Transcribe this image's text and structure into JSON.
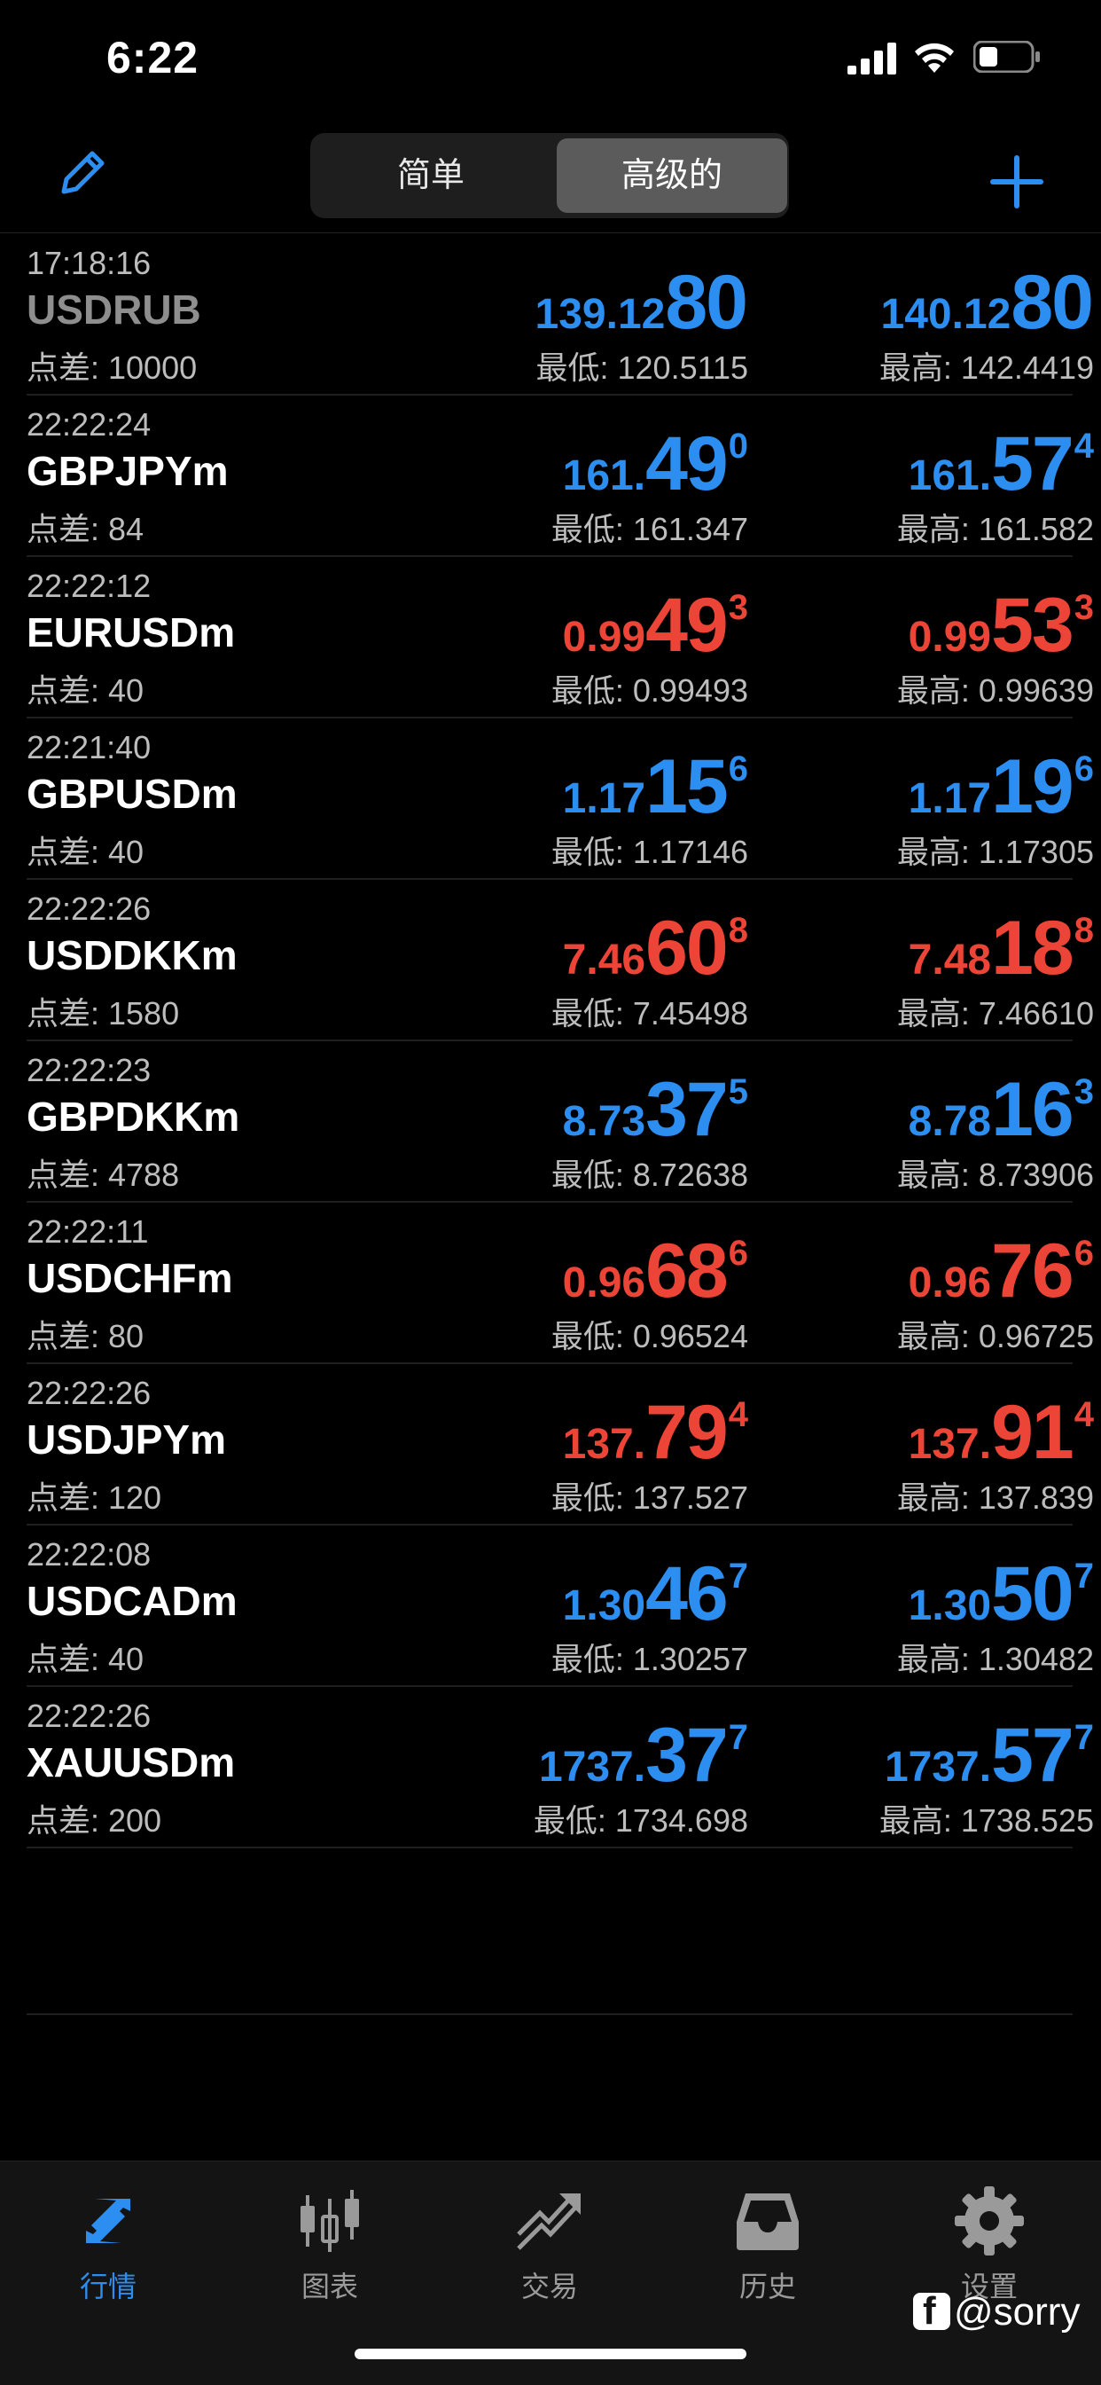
{
  "status": {
    "time": "6:22"
  },
  "segmented": {
    "simple": "简单",
    "advanced": "高级的"
  },
  "quotes": [
    {
      "time": "17:18:16",
      "symbol": "USDRUB",
      "spread": "点差: 10000",
      "color": "blue",
      "dim": true,
      "bid": {
        "small": "139.12",
        "big": "80",
        "sup": ""
      },
      "ask": {
        "small": "140.12",
        "big": "80",
        "sup": ""
      },
      "low": "最低: 120.5115",
      "high": "最高: 142.4419"
    },
    {
      "time": "22:22:24",
      "symbol": "GBPJPYm",
      "spread": "点差: 84",
      "color": "blue",
      "dim": false,
      "bid": {
        "small": "161.",
        "big": "49",
        "sup": "0"
      },
      "ask": {
        "small": "161.",
        "big": "57",
        "sup": "4"
      },
      "low": "最低: 161.347",
      "high": "最高: 161.582"
    },
    {
      "time": "22:22:12",
      "symbol": "EURUSDm",
      "spread": "点差: 40",
      "color": "red",
      "dim": false,
      "bid": {
        "small": "0.99",
        "big": "49",
        "sup": "3"
      },
      "ask": {
        "small": "0.99",
        "big": "53",
        "sup": "3"
      },
      "low": "最低: 0.99493",
      "high": "最高: 0.99639"
    },
    {
      "time": "22:21:40",
      "symbol": "GBPUSDm",
      "spread": "点差: 40",
      "color": "blue",
      "dim": false,
      "bid": {
        "small": "1.17",
        "big": "15",
        "sup": "6"
      },
      "ask": {
        "small": "1.17",
        "big": "19",
        "sup": "6"
      },
      "low": "最低: 1.17146",
      "high": "最高: 1.17305"
    },
    {
      "time": "22:22:26",
      "symbol": "USDDKKm",
      "spread": "点差: 1580",
      "color": "red",
      "dim": false,
      "bid": {
        "small": "7.46",
        "big": "60",
        "sup": "8"
      },
      "ask": {
        "small": "7.48",
        "big": "18",
        "sup": "8"
      },
      "low": "最低: 7.45498",
      "high": "最高: 7.46610"
    },
    {
      "time": "22:22:23",
      "symbol": "GBPDKKm",
      "spread": "点差: 4788",
      "color": "blue",
      "dim": false,
      "bid": {
        "small": "8.73",
        "big": "37",
        "sup": "5"
      },
      "ask": {
        "small": "8.78",
        "big": "16",
        "sup": "3"
      },
      "low": "最低: 8.72638",
      "high": "最高: 8.73906"
    },
    {
      "time": "22:22:11",
      "symbol": "USDCHFm",
      "spread": "点差: 80",
      "color": "red",
      "dim": false,
      "bid": {
        "small": "0.96",
        "big": "68",
        "sup": "6"
      },
      "ask": {
        "small": "0.96",
        "big": "76",
        "sup": "6"
      },
      "low": "最低: 0.96524",
      "high": "最高: 0.96725"
    },
    {
      "time": "22:22:26",
      "symbol": "USDJPYm",
      "spread": "点差: 120",
      "color": "red",
      "dim": false,
      "bid": {
        "small": "137.",
        "big": "79",
        "sup": "4"
      },
      "ask": {
        "small": "137.",
        "big": "91",
        "sup": "4"
      },
      "low": "最低: 137.527",
      "high": "最高: 137.839"
    },
    {
      "time": "22:22:08",
      "symbol": "USDCADm",
      "spread": "点差: 40",
      "color": "blue",
      "dim": false,
      "bid": {
        "small": "1.30",
        "big": "46",
        "sup": "7"
      },
      "ask": {
        "small": "1.30",
        "big": "50",
        "sup": "7"
      },
      "low": "最低: 1.30257",
      "high": "最高: 1.30482"
    },
    {
      "time": "22:22:26",
      "symbol": "XAUUSDm",
      "spread": "点差: 200",
      "color": "blue",
      "dim": false,
      "bid": {
        "small": "1737.",
        "big": "37",
        "sup": "7"
      },
      "ask": {
        "small": "1737.",
        "big": "57",
        "sup": "7"
      },
      "low": "最低: 1734.698",
      "high": "最高: 1738.525"
    }
  ],
  "tabs": [
    {
      "label": "行情",
      "icon": "quotes-arrows-icon",
      "active": true
    },
    {
      "label": "图表",
      "icon": "candlestick-chart-icon",
      "active": false
    },
    {
      "label": "交易",
      "icon": "trade-trend-icon",
      "active": false
    },
    {
      "label": "历史",
      "icon": "history-tray-icon",
      "active": false
    },
    {
      "label": "设置",
      "icon": "gear-icon",
      "active": false
    }
  ],
  "watermark": "@sorry",
  "colors": {
    "blue": "#2b8ef0",
    "red": "#ec4436",
    "background": "#000000"
  }
}
